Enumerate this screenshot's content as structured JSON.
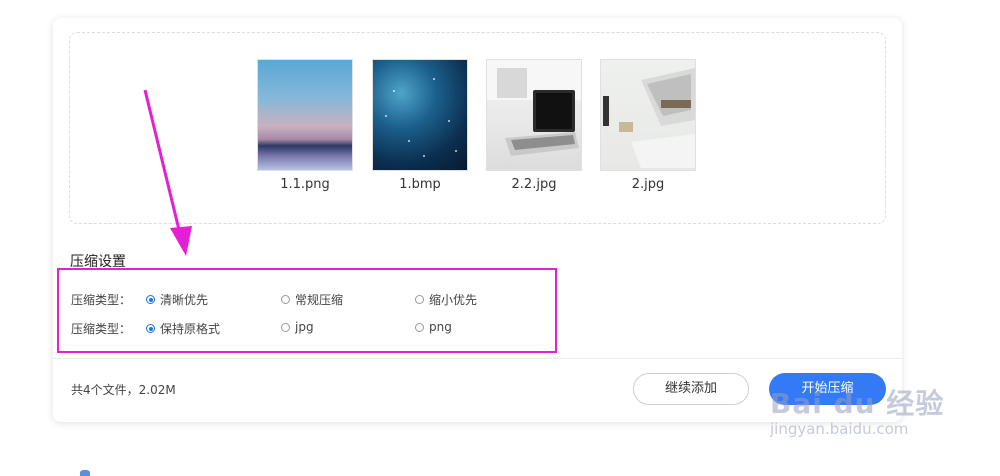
{
  "files": [
    {
      "name": "1.1.png",
      "thumb": "sky-sunset-image"
    },
    {
      "name": "1.bmp",
      "thumb": "starry-space-image"
    },
    {
      "name": "2.2.jpg",
      "thumb": "laptop-desk-image"
    },
    {
      "name": "2.jpg",
      "thumb": "printer-desk-image"
    }
  ],
  "settings": {
    "title": "压缩设置",
    "rows": [
      {
        "label": "压缩类型：",
        "options": [
          "清晰优先",
          "常规压缩",
          "缩小优先"
        ],
        "selected": 0
      },
      {
        "label": "压缩类型：",
        "options": [
          "保持原格式",
          "jpg",
          "png"
        ],
        "selected": 0
      }
    ]
  },
  "footer": {
    "summary": "共4个文件，2.02M",
    "add_more_label": "继续添加",
    "start_label": "开始压缩"
  },
  "watermark": {
    "main": "Bai du 经验",
    "sub": "jingyan.baidu.com"
  },
  "colors": {
    "accent": "#3479f5",
    "highlight_box": "#e41fd6",
    "arrow": "#e41fd6"
  }
}
